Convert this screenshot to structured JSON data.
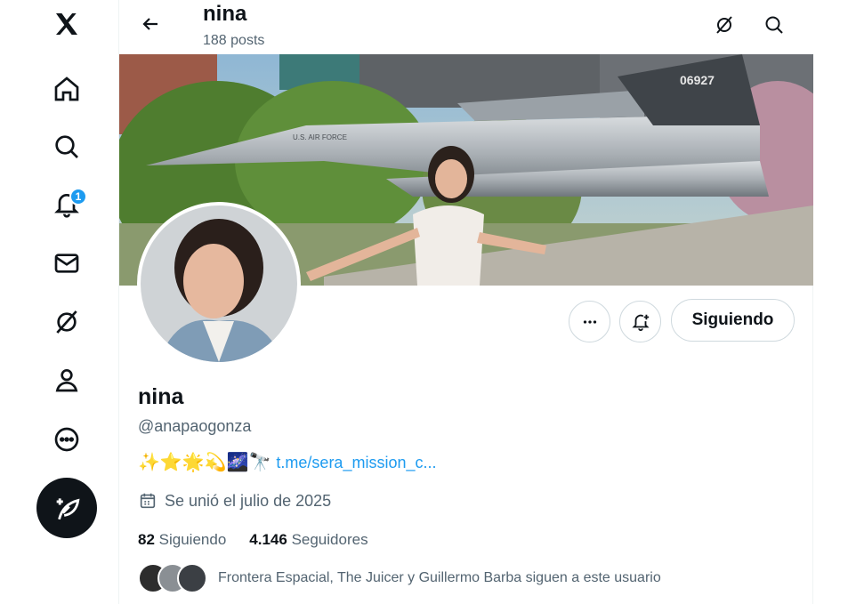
{
  "nav": {
    "items": [
      {
        "name": "x-logo-icon"
      },
      {
        "name": "home-icon"
      },
      {
        "name": "search-icon"
      },
      {
        "name": "bell-icon",
        "badge": "1"
      },
      {
        "name": "mail-icon"
      },
      {
        "name": "grok-icon"
      },
      {
        "name": "profile-icon"
      },
      {
        "name": "more-icon"
      }
    ],
    "compose_icon": "compose-feather-icon"
  },
  "header": {
    "title": "nina",
    "posts": "188 posts",
    "back_icon": "arrow-left-icon",
    "grok_icon": "grok-icon",
    "search_icon": "search-icon"
  },
  "banner": {
    "tail_number": "06927",
    "fuselage_text": "U.S. AIR FORCE"
  },
  "actions": {
    "more_icon": "more-horizontal-icon",
    "notify_icon": "bell-plus-icon",
    "follow_label": "Siguiendo"
  },
  "profile": {
    "name": "nina",
    "handle": "@anapaogonza",
    "bio_emojis": "✨⭐🌟💫🌌🔭",
    "bio_link": "t.me/sera_mission_c...",
    "joined": "Se unió el julio de 2025",
    "following_count": "82",
    "following_label": "Siguiendo",
    "followers_count": "4.146",
    "followers_label": "Seguidores",
    "mutuals_text": "Frontera Espacial, The Juicer y Guillermo Barba siguen a este usuario"
  },
  "colors": {
    "accent": "#1d9bf0",
    "text": "#0f1419",
    "secondary": "#536471"
  }
}
